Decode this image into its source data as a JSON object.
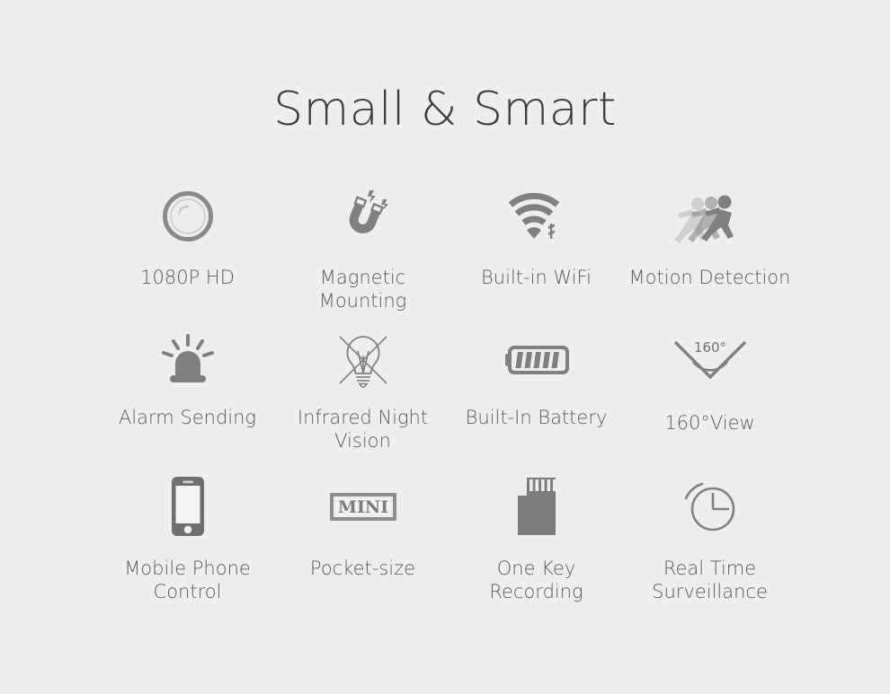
{
  "page": {
    "title": "Small & Smart",
    "background_color": "#eeeeee",
    "title_color": "#3c3c3c",
    "label_color": "#5a5a5a",
    "icon_color": "#808080"
  },
  "features": {
    "row1": [
      {
        "label": "1080P HD",
        "icon": "camera-lens-icon"
      },
      {
        "label": "Magnetic Mounting",
        "icon": "magnet-icon"
      },
      {
        "label": "Built-in WiFi",
        "icon": "wifi-icon"
      },
      {
        "label": "Motion Detection",
        "icon": "running-people-icon"
      }
    ],
    "row2": [
      {
        "label": "Alarm Sending",
        "icon": "siren-icon"
      },
      {
        "label": "Infrared Night Vision",
        "icon": "crossed-out-bulb-icon"
      },
      {
        "label": "Built-In Battery",
        "icon": "battery-icon"
      },
      {
        "label": "160°View",
        "icon": "wide-angle-icon",
        "angle_text": "160°"
      }
    ],
    "row3": [
      {
        "label": "Mobile Phone\nControl",
        "icon": "smartphone-icon"
      },
      {
        "label": "Pocket-size",
        "icon": "mini-badge-icon",
        "badge_text": "MINI"
      },
      {
        "label": "One Key Recording",
        "icon": "sd-card-icon"
      },
      {
        "label": "Real Time\nSurveillance",
        "icon": "clock-icon"
      }
    ]
  }
}
